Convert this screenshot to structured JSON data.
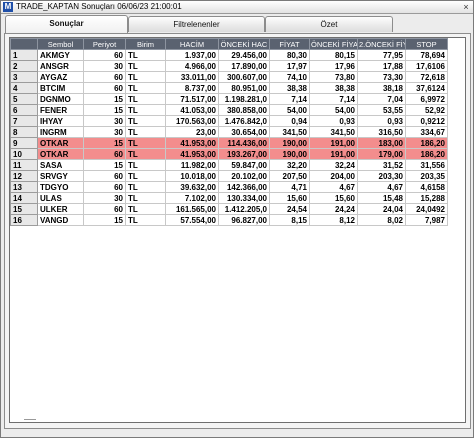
{
  "window": {
    "icon_glyph": "M",
    "title": "TRADE_KAPTAN Sonuçları 06/06/23 21:00:01",
    "close_glyph": "×"
  },
  "tabs": [
    {
      "label": "Sonuçlar",
      "active": true
    },
    {
      "label": "Filtrelenenler",
      "active": false
    },
    {
      "label": "Özet",
      "active": false
    }
  ],
  "table": {
    "columns": [
      "Sembol",
      "Periyot",
      "Birim",
      "HACİM",
      "ÖNCEKİ HAC",
      "FİYAT",
      "ÖNCEKİ FİYA",
      "2.ÖNCEKİ FİY",
      "STOP"
    ],
    "rows": [
      {
        "idx": "1",
        "sembol": "AKMGY",
        "periyot": "60",
        "birim": "TL",
        "hacim": "1.937,00",
        "onceki_hacim": "29.456,00",
        "fiyat": "80,30",
        "onceki_fiyat": "80,15",
        "onceki2_fiyat": "77,95",
        "stop": "78,694",
        "highlight": false
      },
      {
        "idx": "2",
        "sembol": "ANSGR",
        "periyot": "30",
        "birim": "TL",
        "hacim": "4.966,00",
        "onceki_hacim": "17.890,00",
        "fiyat": "17,97",
        "onceki_fiyat": "17,96",
        "onceki2_fiyat": "17,88",
        "stop": "17,6106",
        "highlight": false
      },
      {
        "idx": "3",
        "sembol": "AYGAZ",
        "periyot": "60",
        "birim": "TL",
        "hacim": "33.011,00",
        "onceki_hacim": "300.607,00",
        "fiyat": "74,10",
        "onceki_fiyat": "73,80",
        "onceki2_fiyat": "73,30",
        "stop": "72,618",
        "highlight": false
      },
      {
        "idx": "4",
        "sembol": "BTCIM",
        "periyot": "60",
        "birim": "TL",
        "hacim": "8.737,00",
        "onceki_hacim": "80.951,00",
        "fiyat": "38,38",
        "onceki_fiyat": "38,38",
        "onceki2_fiyat": "38,18",
        "stop": "37,6124",
        "highlight": false
      },
      {
        "idx": "5",
        "sembol": "DGNMO",
        "periyot": "15",
        "birim": "TL",
        "hacim": "71.517,00",
        "onceki_hacim": "1.198.281,0",
        "fiyat": "7,14",
        "onceki_fiyat": "7,14",
        "onceki2_fiyat": "7,04",
        "stop": "6,9972",
        "highlight": false
      },
      {
        "idx": "6",
        "sembol": "FENER",
        "periyot": "15",
        "birim": "TL",
        "hacim": "41.053,00",
        "onceki_hacim": "380.858,00",
        "fiyat": "54,00",
        "onceki_fiyat": "54,00",
        "onceki2_fiyat": "53,55",
        "stop": "52,92",
        "highlight": false
      },
      {
        "idx": "7",
        "sembol": "IHYAY",
        "periyot": "30",
        "birim": "TL",
        "hacim": "170.563,00",
        "onceki_hacim": "1.476.842,0",
        "fiyat": "0,94",
        "onceki_fiyat": "0,93",
        "onceki2_fiyat": "0,93",
        "stop": "0,9212",
        "highlight": false
      },
      {
        "idx": "8",
        "sembol": "INGRM",
        "periyot": "30",
        "birim": "TL",
        "hacim": "23,00",
        "onceki_hacim": "30.654,00",
        "fiyat": "341,50",
        "onceki_fiyat": "341,50",
        "onceki2_fiyat": "316,50",
        "stop": "334,67",
        "highlight": false
      },
      {
        "idx": "9",
        "sembol": "OTKAR",
        "periyot": "15",
        "birim": "TL",
        "hacim": "41.953,00",
        "onceki_hacim": "114.436,00",
        "fiyat": "190,00",
        "onceki_fiyat": "191,00",
        "onceki2_fiyat": "183,00",
        "stop": "186,20",
        "highlight": true
      },
      {
        "idx": "10",
        "sembol": "OTKAR",
        "periyot": "60",
        "birim": "TL",
        "hacim": "41.953,00",
        "onceki_hacim": "193.267,00",
        "fiyat": "190,00",
        "onceki_fiyat": "191,00",
        "onceki2_fiyat": "179,00",
        "stop": "186,20",
        "highlight": true
      },
      {
        "idx": "11",
        "sembol": "SASA",
        "periyot": "15",
        "birim": "TL",
        "hacim": "11.982,00",
        "onceki_hacim": "59.847,00",
        "fiyat": "32,20",
        "onceki_fiyat": "32,24",
        "onceki2_fiyat": "31,52",
        "stop": "31,556",
        "highlight": false
      },
      {
        "idx": "12",
        "sembol": "SRVGY",
        "periyot": "60",
        "birim": "TL",
        "hacim": "10.018,00",
        "onceki_hacim": "20.102,00",
        "fiyat": "207,50",
        "onceki_fiyat": "204,00",
        "onceki2_fiyat": "203,30",
        "stop": "203,35",
        "highlight": false
      },
      {
        "idx": "13",
        "sembol": "TDGYO",
        "periyot": "60",
        "birim": "TL",
        "hacim": "39.632,00",
        "onceki_hacim": "142.366,00",
        "fiyat": "4,71",
        "onceki_fiyat": "4,67",
        "onceki2_fiyat": "4,67",
        "stop": "4,6158",
        "highlight": false
      },
      {
        "idx": "14",
        "sembol": "ULAS",
        "periyot": "30",
        "birim": "TL",
        "hacim": "7.102,00",
        "onceki_hacim": "130.334,00",
        "fiyat": "15,60",
        "onceki_fiyat": "15,60",
        "onceki2_fiyat": "15,48",
        "stop": "15,288",
        "highlight": false
      },
      {
        "idx": "15",
        "sembol": "ULKER",
        "periyot": "60",
        "birim": "TL",
        "hacim": "161.565,00",
        "onceki_hacim": "1.412.205,0",
        "fiyat": "24,54",
        "onceki_fiyat": "24,24",
        "onceki2_fiyat": "24,04",
        "stop": "24,0492",
        "highlight": false
      },
      {
        "idx": "16",
        "sembol": "VANGD",
        "periyot": "15",
        "birim": "TL",
        "hacim": "57.554,00",
        "onceki_hacim": "96.827,00",
        "fiyat": "8,15",
        "onceki_fiyat": "8,12",
        "onceki2_fiyat": "8,02",
        "stop": "7,987",
        "highlight": false
      }
    ]
  },
  "colors": {
    "header_bg": "#5a6270",
    "highlight_row": "#f38d8d"
  }
}
